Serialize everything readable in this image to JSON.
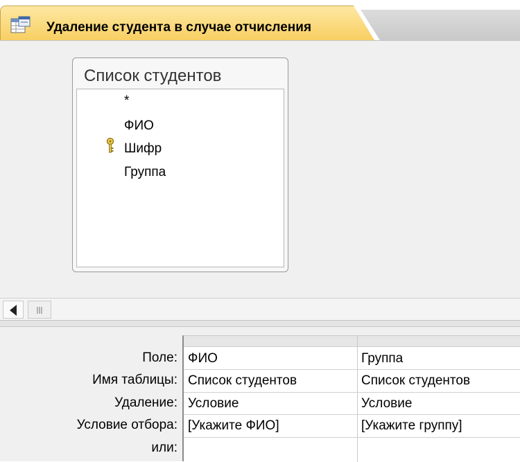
{
  "tab": {
    "title": "Удаление студента в случае отчисления",
    "icon": "query-design-icon"
  },
  "table": {
    "title": "Список студентов",
    "fields": [
      "*",
      "ФИО",
      "Шифр",
      "Группа"
    ],
    "key_field": "Шифр"
  },
  "qbe": {
    "row_labels": [
      "Поле:",
      "Имя таблицы:",
      "Удаление:",
      "Условие отбора:",
      "или:"
    ],
    "columns": [
      {
        "field": "ФИО",
        "table": "Список студентов",
        "delete": "Условие",
        "criteria": "[Укажите ФИО]",
        "or": ""
      },
      {
        "field": "Группа",
        "table": "Список студентов",
        "delete": "Условие",
        "criteria": "[Укажите группу]",
        "or": ""
      }
    ]
  },
  "colors": {
    "tab_active": "#f8cf62",
    "panel_bg": "#f0f0f0"
  }
}
